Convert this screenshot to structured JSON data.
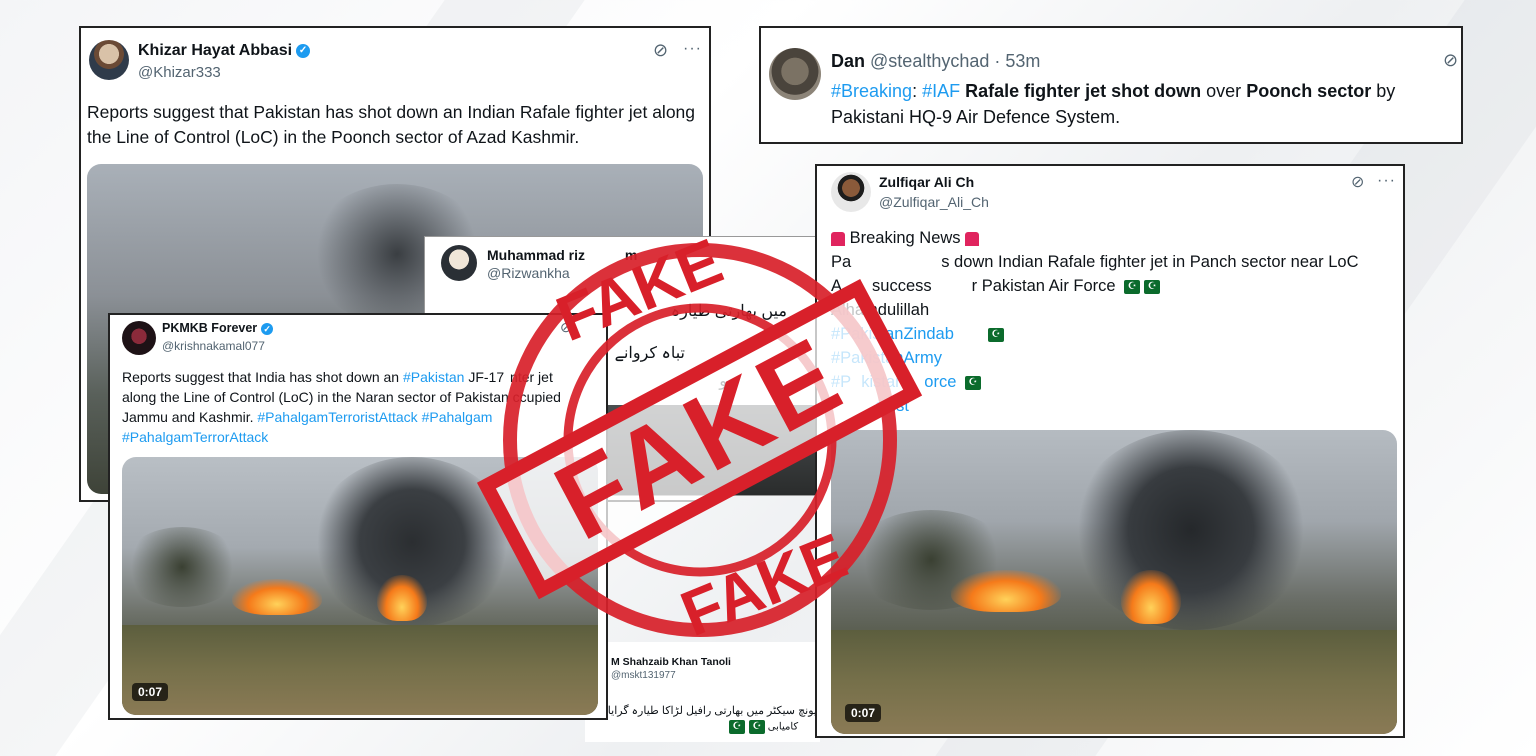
{
  "tweets": {
    "khizar": {
      "name": "Khizar Hayat Abbasi",
      "handle": "@Khizar333",
      "text": "Reports suggest that Pakistan has shot down an Indian Rafale fighter jet along the Line of Control (LoC) in the Poonch sector of Azad Kashmir."
    },
    "dan": {
      "name": "Dan",
      "handle_time": "@stealthychad · 53m",
      "tag_breaking": "#Breaking",
      "colon": ":",
      "tag_iaf": "#IAF",
      "bold1": "Rafale fighter jet shot down",
      "over": "over",
      "bold2": "Poonch sector",
      "by": "by",
      "line2": "Pakistani HQ-9 Air Defence System."
    },
    "rizwan": {
      "name": "Muhammad riz",
      "name_tail": "m",
      "handle": "@Rizwankha",
      "urdu1": "میں بھارتی طیارہ",
      "urdu2": "تباہ کروانے",
      "urdu3": "و"
    },
    "pkmkb": {
      "name": "PKMKB Forever",
      "handle": "@krishnakamal077",
      "t1": "Reports suggest that India has shot down an",
      "tag_pak": "#Pakistan",
      "t2": "JF-17",
      "t3": "nter jet",
      "t4": "along the Line of Control (LoC) in the Naran sector of Pakistan",
      "t5": "ccupied",
      "t6": "Jammu and Kashmir.",
      "tag1": "#PahalgamTerroristAttack",
      "tag2": "#Pahalgam",
      "tag3": "#PahalgamTerrorAttack",
      "duration": "0:07"
    },
    "zulfiqar": {
      "name": "Zulfiqar Ali Ch",
      "handle": "@Zulfiqar_Ali_Ch",
      "breaking": "Breaking News",
      "l2a": "Pa",
      "l2b": "s down Indian Rafale fighter jet in Panch sector near LoC",
      "l3a": "A",
      "l3b": "success",
      "l3c": "r Pakistan Air Force",
      "l4": "Alhamdulillah",
      "tag1": "#PakistanZindab",
      "tag2": "#PakistanArmy",
      "tag3a": "#P",
      "tag3b": "kistan",
      "tag3c": "orce",
      "tag4": "akist",
      "duration": "0:07"
    },
    "shahzaib": {
      "name": "M Shahzaib Khan Tanoli",
      "handle": "@mskt131977",
      "urdu": "پونچ سیکٹر میں بھارتی رافیل لڑاکا طیارہ گرایا",
      "urdu2": "کامیابی"
    }
  },
  "stamp": {
    "word": "FAKE",
    "color": "#d8202a"
  },
  "icons": [
    "verified-badge",
    "grok-icon",
    "more-dots",
    "flag-pk",
    "siren"
  ]
}
